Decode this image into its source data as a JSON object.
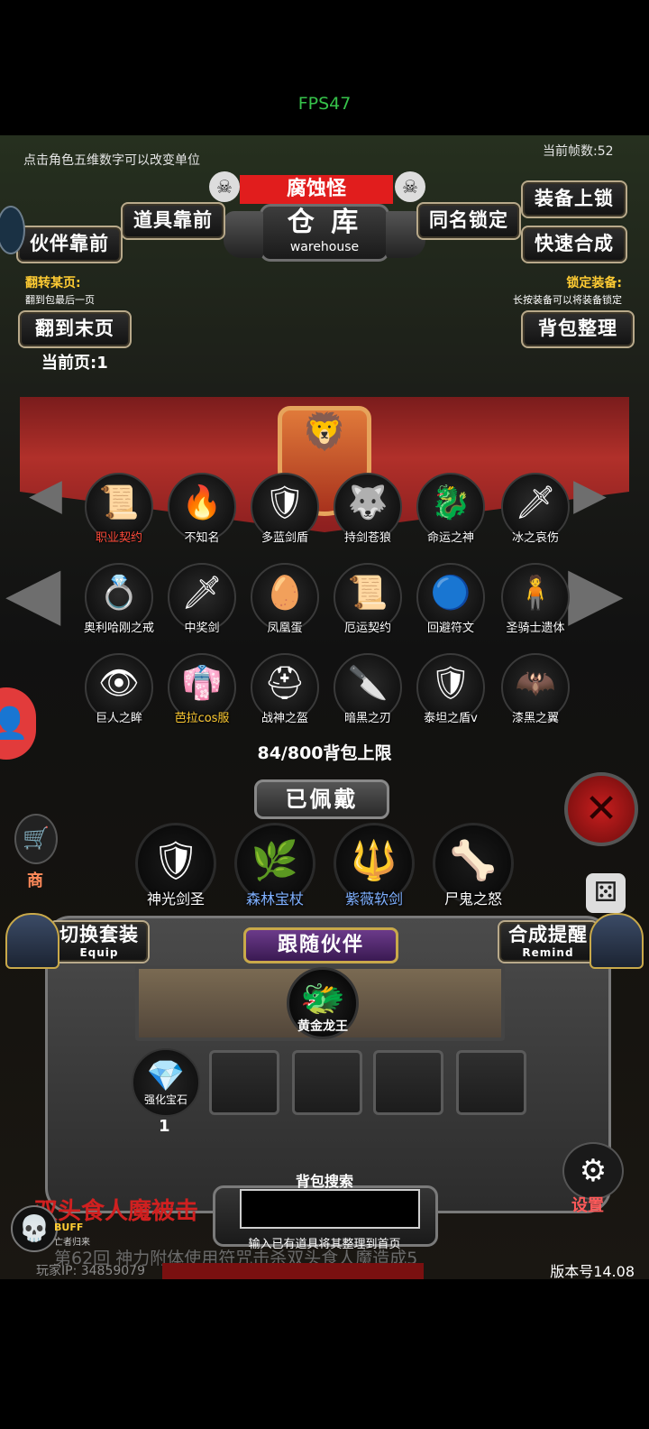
{
  "status": {
    "fps": "FPS47"
  },
  "header": {
    "hint": "点击角色五维数字可以改变单位",
    "frame_count": "当前帧数:52",
    "monster_name": "腐蚀怪",
    "title": "仓 库",
    "subtitle": "warehouse"
  },
  "buttons": {
    "items_front": "道具靠前",
    "partner_front": "伙伴靠前",
    "same_name_lock": "同名锁定",
    "equip_lock": "装备上锁",
    "quick_combine": "快速合成",
    "to_last_page": "翻到末页",
    "bag_sort": "背包整理"
  },
  "notes": {
    "flip_title": "翻转某页:",
    "flip_desc": "翻到包最后一页",
    "lock_title": "锁定装备:",
    "lock_desc": "长按装备可以将装备锁定",
    "current_page": "当前页:1"
  },
  "items": [
    {
      "label": "职业契约",
      "icon": "scroll-icon",
      "glyph": "📜",
      "color": "#ff4b3a"
    },
    {
      "label": "不知名",
      "icon": "flame-beast-icon",
      "glyph": "🔥",
      "color": "#ffffff"
    },
    {
      "label": "多蓝剑盾",
      "icon": "shield-icon",
      "glyph": "🛡",
      "color": "#ffffff"
    },
    {
      "label": "持剑苍狼",
      "icon": "wolf-icon",
      "glyph": "🐺",
      "color": "#ffffff"
    },
    {
      "label": "命运之神",
      "icon": "blue-dragon-icon",
      "glyph": "🐉",
      "color": "#ffffff"
    },
    {
      "label": "冰之哀伤",
      "icon": "ice-sword-icon",
      "glyph": "🗡",
      "color": "#ffffff"
    },
    {
      "label": "奥利哈刚之戒",
      "icon": "ring-icon",
      "glyph": "💍",
      "color": "#ffffff"
    },
    {
      "label": "中奖剑",
      "icon": "sword-icon",
      "glyph": "🗡",
      "color": "#ffffff"
    },
    {
      "label": "凤凰蛋",
      "icon": "egg-icon",
      "glyph": "🥚",
      "color": "#ffffff"
    },
    {
      "label": "厄运契约",
      "icon": "purple-scroll-icon",
      "glyph": "📜",
      "color": "#ffffff"
    },
    {
      "label": "回避符文",
      "icon": "blue-orb-icon",
      "glyph": "🔵",
      "color": "#ffffff"
    },
    {
      "label": "圣骑士遗体",
      "icon": "body-icon",
      "glyph": "🧍",
      "color": "#ffffff"
    },
    {
      "label": "巨人之眸",
      "icon": "eye-icon",
      "glyph": "👁",
      "color": "#ffffff"
    },
    {
      "label": "芭拉cos服",
      "icon": "costume-icon",
      "glyph": "👘",
      "color": "#ffcc33"
    },
    {
      "label": "战神之盔",
      "icon": "helmet-icon",
      "glyph": "⛑",
      "color": "#ffffff"
    },
    {
      "label": "暗黑之刃",
      "icon": "dark-blade-icon",
      "glyph": "🔪",
      "color": "#ffffff"
    },
    {
      "label": "泰坦之盾v",
      "icon": "titan-shield-icon",
      "glyph": "🛡",
      "color": "#ffffff"
    },
    {
      "label": "漆黑之翼",
      "icon": "black-wings-icon",
      "glyph": "🦇",
      "color": "#ffffff"
    }
  ],
  "bag_capacity": "84/800背包上限",
  "equipped": {
    "title": "已佩戴",
    "items": [
      {
        "label": "神光剑圣",
        "icon": "knight-icon",
        "glyph": "🛡",
        "color": "#ffffff"
      },
      {
        "label": "森林宝杖",
        "icon": "staff-icon",
        "glyph": "🌿",
        "color": "#7fb0ff"
      },
      {
        "label": "紫薇软剑",
        "icon": "spear-icon",
        "glyph": "🔱",
        "color": "#7fb0ff"
      },
      {
        "label": "尸鬼之怒",
        "icon": "claw-icon",
        "glyph": "🦴",
        "color": "#ffffff"
      }
    ]
  },
  "equip_switch": {
    "label": "切换套装",
    "sub": "Equip"
  },
  "combine_remind": {
    "label": "合成提醒",
    "sub": "Remind"
  },
  "follow_partner": {
    "title": "跟随伙伴",
    "name": "黄金龙王",
    "glyph": "🐲"
  },
  "slots": [
    {
      "label": "强化宝石",
      "count": "1",
      "glyph": "💎"
    }
  ],
  "search": {
    "title": "背包搜索",
    "desc": "输入已有道具将其整理到首页"
  },
  "side": {
    "shop": "商",
    "settings": "设置",
    "buff": "BUFF",
    "buff_sub": "亡者归来"
  },
  "footer": {
    "scroll_text": "双头食人魔被击",
    "scroll_text2": "第62回 神力附体使用符咒击杀双头食人魔造成5",
    "player_ip": "玩家IP: 34859079",
    "version": "版本号14.08"
  },
  "colors": {
    "accent_red": "#e11d1d",
    "banner_red": "#b1302a",
    "gold": "#ffcc33",
    "frame": "#b8a98a"
  }
}
